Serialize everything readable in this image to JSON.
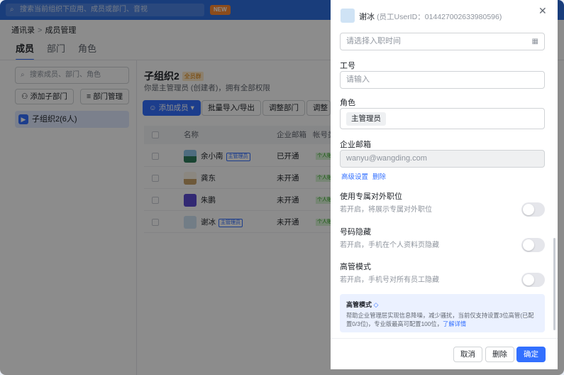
{
  "topbar": {
    "search_placeholder": "搜索当前组织下应用、成员或部门、音视",
    "new_badge": "NEW",
    "brand_color": "#2f6fe0"
  },
  "breadcrumb": {
    "root": "通讯录",
    "separator": ">",
    "current": "成员管理"
  },
  "tabs": [
    {
      "label": "成员",
      "active": true
    },
    {
      "label": "部门",
      "active": false
    },
    {
      "label": "角色",
      "active": false
    }
  ],
  "sidebar": {
    "search_placeholder": "搜索成员、部门、角色",
    "add_sub_org": "添加子部门",
    "dept_manage": "部门管理",
    "org_item": "子组织2(6人)"
  },
  "main": {
    "title": "子组织2",
    "title_badge": "全员群",
    "subtitle": "你是主管理员 (创建者)，拥有全部权限",
    "buttons": {
      "add_member": "添加成员",
      "import_export": "批量导入/导出",
      "adjust_dept": "调整部门",
      "adjust_more": "调整"
    },
    "columns": [
      "名称",
      "企业邮箱",
      "帐号类"
    ],
    "rows": [
      {
        "name": "余小南",
        "tag": "主管理员",
        "email_status": "已开通",
        "account": "个人账"
      },
      {
        "name": "龚东",
        "tag": "",
        "email_status": "未开通",
        "account": "个人账"
      },
      {
        "name": "朱鹏",
        "tag": "",
        "email_status": "未开通",
        "account": "个人账"
      },
      {
        "name": "谢冰",
        "tag": "主管理员",
        "email_status": "未开通",
        "account": "个人账"
      }
    ]
  },
  "drawer": {
    "name": "谢冰",
    "uid_text": "(员工UserID：014427002633980596)",
    "join_date_placeholder": "请选择入职时间",
    "employee_no_label": "工号",
    "employee_no_placeholder": "请输入",
    "role_label": "角色",
    "role_value": "主管理员",
    "email_label": "企业邮箱",
    "email_value": "wanyu@wangding.com",
    "advanced_settings": "高级设置",
    "delete_link": "删除",
    "exclusive_title": "使用专属对外职位",
    "exclusive_desc": "若开启，将展示专属对外职位",
    "hide_phone_title": "号码隐藏",
    "hide_phone_desc": "若开启，手机在个人资料页隐藏",
    "exec_mode_title": "高管模式",
    "exec_mode_desc": "若开启，手机号对所有员工隐藏",
    "info_title": "高管模式",
    "info_body": "帮助企业管理层实现信息降噪，减少骚扰，当前仅支持设置3位高管(已配置0/3位)，专业版最高可配置100位，",
    "info_link": "了解详情",
    "cancel": "取消",
    "delete": "删除",
    "confirm": "确定",
    "accent_color": "#3370ff"
  }
}
